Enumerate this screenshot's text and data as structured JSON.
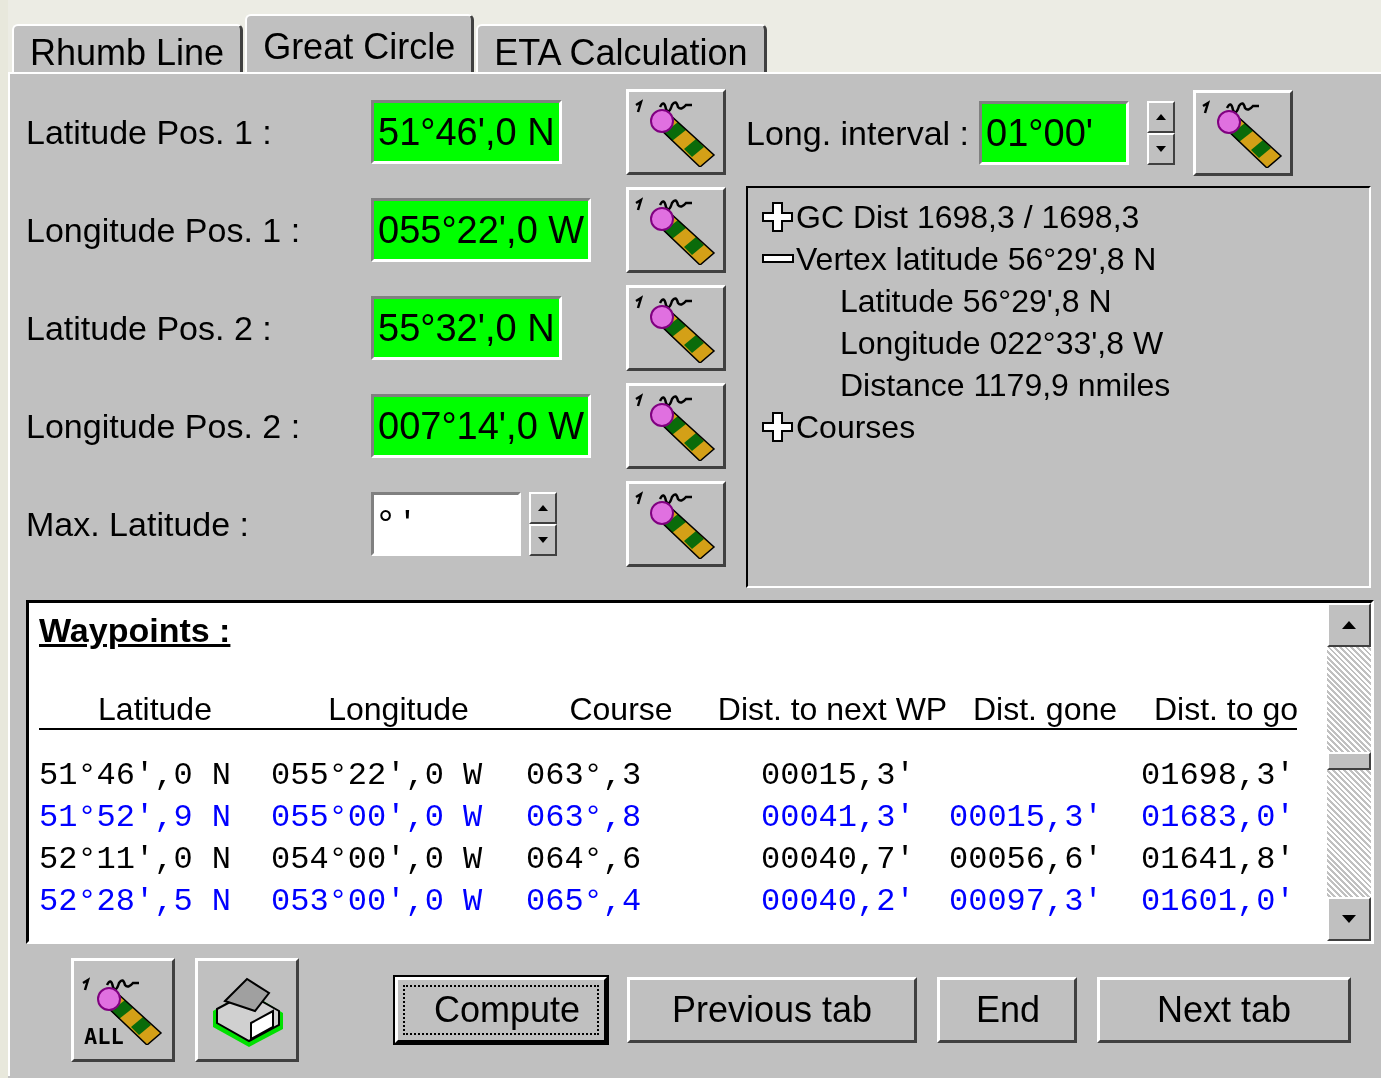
{
  "tabs": [
    {
      "label": "Rhumb Line",
      "selected": false
    },
    {
      "label": "Great Circle",
      "selected": true
    },
    {
      "label": "ETA Calculation",
      "selected": false
    }
  ],
  "fields": [
    {
      "label": "Latitude Pos. 1 :",
      "value": "51°46',0 N",
      "filled": true,
      "kind": "plain"
    },
    {
      "label": "Longitude Pos. 1 :",
      "value": "055°22',0 W",
      "filled": true,
      "kind": "plain"
    },
    {
      "label": "Latitude Pos. 2 :",
      "value": "55°32',0 N",
      "filled": true,
      "kind": "plain"
    },
    {
      "label": "Longitude Pos. 2 :",
      "value": "007°14',0 W",
      "filled": true,
      "kind": "plain"
    },
    {
      "label": "Max. Latitude :",
      "value": "°  '",
      "filled": false,
      "kind": "spin"
    }
  ],
  "interval": {
    "label": "Long. interval :",
    "value": "01°00'",
    "filled": true
  },
  "tree": [
    {
      "text": "GC Dist 1698,3 / 1698,3",
      "expanded": false
    },
    {
      "text": "Vertex latitude 56°29',8 N",
      "expanded": true,
      "children": [
        {
          "text": "Latitude 56°29',8 N"
        },
        {
          "text": "Longitude 022°33',8 W"
        },
        {
          "text": "Distance 1179,9 nmiles"
        }
      ]
    },
    {
      "text": "Courses",
      "expanded": false
    }
  ],
  "waypoints": {
    "title": "Waypoints :",
    "columns": [
      "Latitude",
      "Longitude",
      "Course",
      "Dist. to next WP",
      "Dist. gone",
      "Dist. to go"
    ],
    "rows": [
      {
        "color": "#000000",
        "cells": [
          "51°46',0 N",
          "055°22',0 W",
          "063°,3",
          "00015,3'",
          null,
          "01698,3'"
        ]
      },
      {
        "color": "#0000ff",
        "cells": [
          "51°52',9 N",
          "055°00',0 W",
          "063°,8",
          "00041,3'",
          "00015,3'",
          "01683,0'"
        ]
      },
      {
        "color": "#000000",
        "cells": [
          "52°11',0 N",
          "054°00',0 W",
          "064°,6",
          "00040,7'",
          "00056,6'",
          "01641,8'"
        ]
      },
      {
        "color": "#0000ff",
        "cells": [
          "52°28',5 N",
          "053°00',0 W",
          "065°,4",
          "00040,2'",
          "00097,3'",
          "01601,0'"
        ]
      }
    ]
  },
  "icon_buttons": [
    {
      "kind": "pencil-all",
      "text": "ALL"
    },
    {
      "kind": "printer"
    }
  ],
  "buttons": [
    {
      "label": "Compute",
      "focused": true
    },
    {
      "label": "Previous tab",
      "focused": false
    },
    {
      "label": "End",
      "focused": false
    },
    {
      "label": "Next tab",
      "focused": false
    }
  ]
}
